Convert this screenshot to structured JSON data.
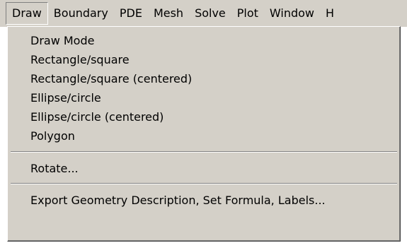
{
  "menubar": {
    "items": [
      {
        "label": "Draw"
      },
      {
        "label": "Boundary"
      },
      {
        "label": "PDE"
      },
      {
        "label": "Mesh"
      },
      {
        "label": "Solve"
      },
      {
        "label": "Plot"
      },
      {
        "label": "Window"
      },
      {
        "label": "H"
      }
    ]
  },
  "draw_menu": {
    "group1": [
      {
        "label": "Draw Mode"
      },
      {
        "label": "Rectangle/square"
      },
      {
        "label": "Rectangle/square (centered)"
      },
      {
        "label": "Ellipse/circle"
      },
      {
        "label": "Ellipse/circle (centered)"
      },
      {
        "label": "Polygon"
      }
    ],
    "rotate_label": "Rotate...",
    "export_label": "Export Geometry Description, Set Formula, Labels..."
  },
  "colors": {
    "menu_background": "#d4d0c8",
    "text": "#000000",
    "separator_dark": "#808080",
    "separator_light": "#ffffff"
  }
}
